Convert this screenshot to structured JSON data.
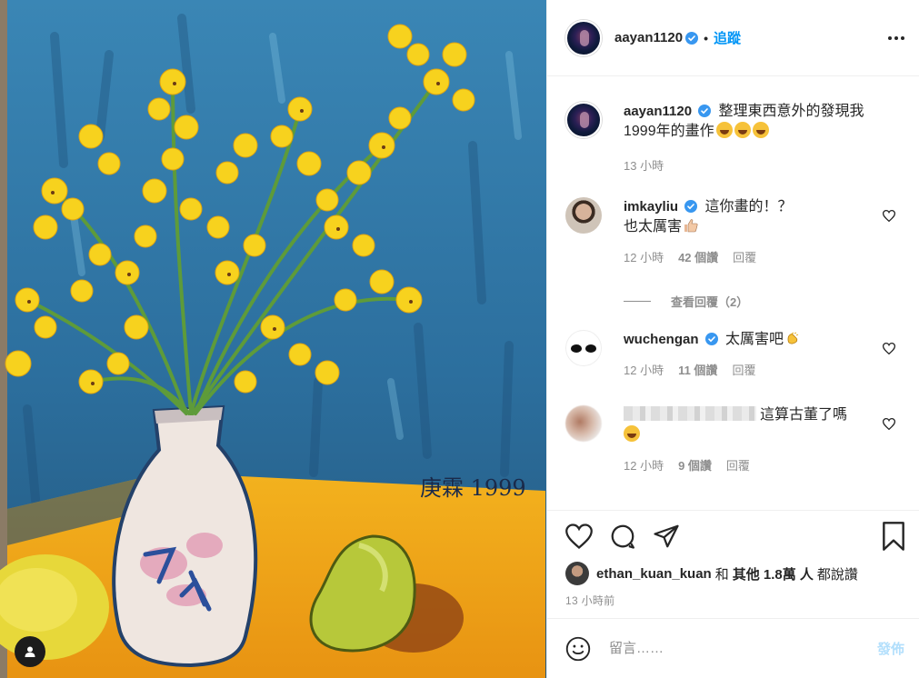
{
  "post": {
    "author": "aayan1120",
    "follow_label": "追蹤",
    "caption_text": "整理東西意外的發現我1999年的畫作",
    "caption_emojis": [
      "rolling-laughing-emoji",
      "rolling-laughing-emoji",
      "rolling-laughing-emoji"
    ],
    "caption_time": "13 小時"
  },
  "comments": [
    {
      "username": "imkayliu",
      "verified": true,
      "text": "這你畫的！？",
      "text2": "也太厲害",
      "emoji": "thumbs-up-emoji",
      "time": "12 小時",
      "likes": "42 個讚",
      "reply": "回覆",
      "view_replies": "查看回覆（2）"
    },
    {
      "username": "wuchengan",
      "verified": true,
      "text": "太厲害吧",
      "emoji": "clapping-hands-emoji",
      "time": "12 小時",
      "likes": "11 個讚",
      "reply": "回覆"
    },
    {
      "username": "",
      "username_blurred": true,
      "text": "這算古董了嗎",
      "emoji": "grinning-emoji",
      "time": "12 小時",
      "likes": "9 個讚",
      "reply": "回覆"
    }
  ],
  "likes_line": {
    "user": "ethan_kuan_kuan",
    "connector": "和",
    "others": "其他 1.8萬 人",
    "suffix": "都說讚"
  },
  "post_time": "13 小時前",
  "comment_box": {
    "placeholder": "留言……",
    "post_label": "發佈"
  },
  "artwork": {
    "signature": "庚霖 1999",
    "description_colors": {
      "background": "#2f6f9c",
      "table": "#f0a81c",
      "flowers": "#f7d21e",
      "vase": "#efe6e0"
    }
  },
  "colors": {
    "link_blue": "#0095f6",
    "muted": "#8e8e8e",
    "post_disabled": "#b2dffc",
    "verified_blue": "#3897f0"
  }
}
